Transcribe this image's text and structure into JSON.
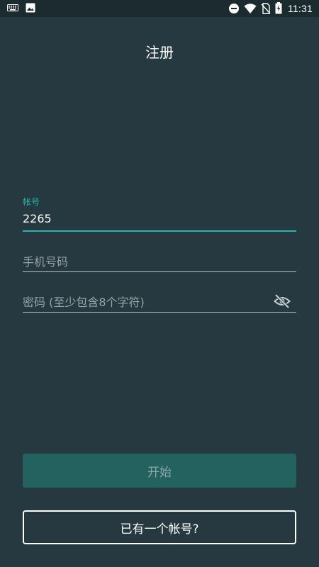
{
  "status_bar": {
    "time": "11:31",
    "left_icons": [
      "keyboard-icon",
      "image-icon"
    ],
    "right_icons": [
      "do-not-disturb-icon",
      "wifi-icon",
      "no-sim-icon",
      "battery-charging-icon"
    ]
  },
  "page": {
    "title": "注册"
  },
  "form": {
    "account": {
      "label": "帐号",
      "value": "2265"
    },
    "phone": {
      "placeholder": "手机号码"
    },
    "password": {
      "placeholder": "密码 (至少包含8个字符)",
      "toggle_icon": "visibility-off-icon"
    }
  },
  "buttons": {
    "start": "开始",
    "have_account": "已有一个帐号?"
  },
  "colors": {
    "background": "#263940",
    "accent": "#26b5a8",
    "start_button": "#246260"
  }
}
